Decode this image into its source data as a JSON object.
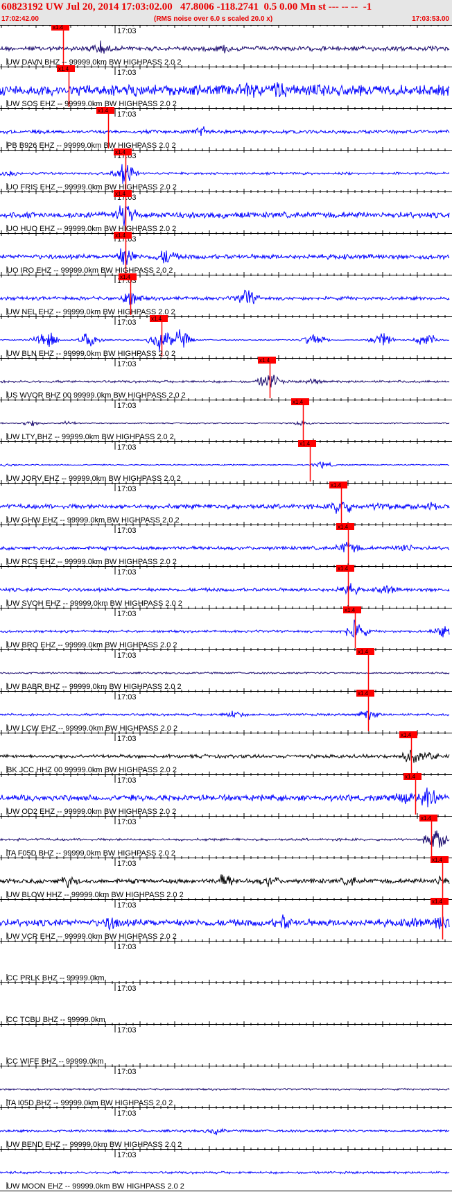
{
  "header": {
    "title": "60823192 UW Jul 20, 2014 17:03:02.00   47.8006 -118.2741  0.5 0.00 Mn st --- -- --  -1",
    "start_time": "17:02:42.00",
    "subtitle": "(RMS noise over 6.0 s scaled 20.0 x)",
    "end_time": "17:03:53.00"
  },
  "colors": {
    "header_bg": "#e6e6e6",
    "header_text": "#e80000",
    "pick": "#ff0000",
    "trace_blue": "#0000ff",
    "trace_navy": "#1a0a6e",
    "trace_black": "#000000"
  },
  "chart_data": {
    "type": "line",
    "title": "",
    "x_ticks_label": "17:03",
    "pick_label": "x1.4",
    "x_range": [
      "17:02:42.00",
      "17:03:53.00"
    ],
    "grid": false,
    "traces": [
      {
        "label": "UW DAVN BHZ -- 99999.0km BW  HIGHPASS  2.0  2",
        "pick_frac": 0.141,
        "color": "#1a0a6e",
        "amp": 4,
        "events": [
          [
            0.22,
            14
          ],
          [
            0.5,
            9
          ]
        ]
      },
      {
        "label": "UW SOS EHZ -- 99999.0km BW  HIGHPASS  2.0  2",
        "pick_frac": 0.153,
        "color": "#0000ff",
        "amp": 9,
        "events": [
          [
            0.12,
            10
          ],
          [
            0.3,
            12
          ],
          [
            0.55,
            20
          ],
          [
            0.62,
            20
          ],
          [
            0.72,
            18
          ],
          [
            0.86,
            12
          ]
        ]
      },
      {
        "label": "PB B926 EHZ -- 99999.0km BW  HIGHPASS  2.0  2",
        "pick_frac": 0.24,
        "color": "#0000ff",
        "amp": 3,
        "events": [
          [
            0.45,
            10
          ]
        ]
      },
      {
        "label": "UO FRIS EHZ -- 99999.0km BW  HIGHPASS  2.0  2",
        "pick_frac": 0.28,
        "color": "#0000ff",
        "amp": 2,
        "events": [
          [
            0.28,
            20
          ],
          [
            0.02,
            6
          ]
        ]
      },
      {
        "label": "UO HUO EHZ -- 99999.0km BW  HIGHPASS  2.0  2",
        "pick_frac": 0.28,
        "color": "#0000ff",
        "amp": 5,
        "events": [
          [
            0.28,
            22
          ]
        ]
      },
      {
        "label": "UO IRO EHZ -- 99999.0km BW  HIGHPASS  2.0  2",
        "pick_frac": 0.28,
        "color": "#0000ff",
        "amp": 4,
        "events": [
          [
            0.28,
            20
          ],
          [
            0.37,
            16
          ]
        ]
      },
      {
        "label": "UW NEL EHZ -- 99999.0km BW  HIGHPASS  2.0  2",
        "pick_frac": 0.29,
        "color": "#0000ff",
        "amp": 3,
        "events": [
          [
            0.29,
            14
          ],
          [
            0.55,
            16
          ]
        ]
      },
      {
        "label": "UW BLN EHZ -- 99999.0km BW  HIGHPASS  2.0  2",
        "pick_frac": 0.36,
        "color": "#0000ff",
        "amp": 1,
        "events": [
          [
            0.1,
            18
          ],
          [
            0.2,
            14
          ],
          [
            0.36,
            20
          ],
          [
            0.4,
            18
          ],
          [
            0.7,
            14
          ],
          [
            0.85,
            14
          ],
          [
            0.95,
            12
          ]
        ]
      },
      {
        "label": "US WVOR BHZ 00 99999.0km BW  HIGHPASS  2.0  2",
        "pick_frac": 0.6,
        "color": "#1a0a6e",
        "amp": 2,
        "events": [
          [
            0.6,
            16
          ],
          [
            0.7,
            6
          ]
        ]
      },
      {
        "label": "UW LTY BHZ -- 99999.0km BW  HIGHPASS  2.0  2",
        "pick_frac": 0.674,
        "color": "#1a0a6e",
        "amp": 1,
        "events": [
          [
            0.07,
            5
          ],
          [
            0.15,
            4
          ],
          [
            0.67,
            4
          ]
        ]
      },
      {
        "label": "UW JORV EHZ -- 99999.0km BW  HIGHPASS  2.0  2",
        "pick_frac": 0.69,
        "color": "#0000ff",
        "amp": 1,
        "events": [
          [
            0.02,
            3
          ],
          [
            0.72,
            6
          ]
        ]
      },
      {
        "label": "UW GHW EHZ -- 99999.0km BW  HIGHPASS  2.0  2",
        "pick_frac": 0.76,
        "color": "#0000ff",
        "amp": 4,
        "events": [
          [
            0.76,
            18
          ],
          [
            0.85,
            10
          ],
          [
            0.96,
            8
          ]
        ]
      },
      {
        "label": "UW RCS EHZ -- 99999.0km BW  HIGHPASS  2.0  2",
        "pick_frac": 0.775,
        "color": "#0000ff",
        "amp": 3,
        "events": [
          [
            0.775,
            14
          ],
          [
            0.9,
            10
          ]
        ]
      },
      {
        "label": "UW SVOH EHZ -- 99999.0km BW  HIGHPASS  2.0  2",
        "pick_frac": 0.775,
        "color": "#0000ff",
        "amp": 3,
        "events": [
          [
            0.775,
            12
          ],
          [
            0.86,
            10
          ]
        ]
      },
      {
        "label": "UW BRO EHZ -- 99999.0km BW  HIGHPASS  2.0  2",
        "pick_frac": 0.79,
        "color": "#0000ff",
        "amp": 2,
        "events": [
          [
            0.79,
            20
          ],
          [
            0.985,
            10
          ]
        ]
      },
      {
        "label": "UW BABR BHZ -- 99999.0km BW  HIGHPASS  2.0  2",
        "pick_frac": 0.82,
        "color": "#1a0a6e",
        "amp": 1.5,
        "events": []
      },
      {
        "label": "UW LCW EHZ -- 99999.0km BW  HIGHPASS  2.0  2",
        "pick_frac": 0.82,
        "color": "#0000ff",
        "amp": 2,
        "events": [
          [
            0.52,
            8
          ],
          [
            0.82,
            10
          ]
        ]
      },
      {
        "label": "BK JCC HHZ 00 99999.0km BW  HIGHPASS  2.0  2",
        "pick_frac": 0.915,
        "color": "#000000",
        "amp": 3,
        "events": [
          [
            0.915,
            16
          ],
          [
            0.96,
            8
          ]
        ]
      },
      {
        "label": "UW OD2 EHZ -- 99999.0km BW  HIGHPASS  2.0  2",
        "pick_frac": 0.925,
        "color": "#0000ff",
        "amp": 5,
        "events": [
          [
            0.9,
            14
          ],
          [
            0.95,
            22
          ]
        ]
      },
      {
        "label": "TA F05D BHZ -- 99999.0km BW  HIGHPASS  2.0  2",
        "pick_frac": 0.96,
        "color": "#1a0a6e",
        "amp": 2,
        "events": [
          [
            0.97,
            18
          ]
        ]
      },
      {
        "label": "UW BLOW HHZ -- 99999.0km BW  HIGHPASS  2.0  2",
        "pick_frac": 0.985,
        "color": "#000000",
        "amp": 4,
        "events": [
          [
            0.15,
            12
          ],
          [
            0.5,
            14
          ],
          [
            0.6,
            12
          ],
          [
            0.78,
            10
          ],
          [
            0.985,
            12
          ]
        ]
      },
      {
        "label": "UW VCR EHZ -- 99999.0km BW  HIGHPASS  2.0  2",
        "pick_frac": 0.985,
        "color": "#0000ff",
        "amp": 6,
        "events": [
          [
            0.25,
            16
          ],
          [
            0.63,
            16
          ],
          [
            0.92,
            12
          ],
          [
            0.985,
            18
          ]
        ]
      },
      {
        "label": "CC PRLK BHZ -- 99999.0km",
        "pick_frac": null,
        "color": "#0000ff",
        "amp": 0,
        "events": []
      },
      {
        "label": "CC TCBU BHZ -- 99999.0km",
        "pick_frac": null,
        "color": "#0000ff",
        "amp": 0,
        "events": []
      },
      {
        "label": "CC WIFE BHZ -- 99999.0km",
        "pick_frac": null,
        "color": "#0000ff",
        "amp": 0,
        "events": []
      },
      {
        "label": "TA I05D BHZ -- 99999.0km BW  HIGHPASS  2.0  2",
        "pick_frac": null,
        "color": "#1a0a6e",
        "amp": 1.5,
        "events": []
      },
      {
        "label": "UW BEND EHZ -- 99999.0km BW  HIGHPASS  2.0  2",
        "pick_frac": null,
        "color": "#0000ff",
        "amp": 2,
        "events": [
          [
            0.48,
            7
          ]
        ]
      },
      {
        "label": "UW MOON EHZ -- 99999.0km BW  HIGHPASS  2.0  2",
        "pick_frac": null,
        "color": "#0000ff",
        "amp": 2,
        "events": []
      }
    ]
  }
}
